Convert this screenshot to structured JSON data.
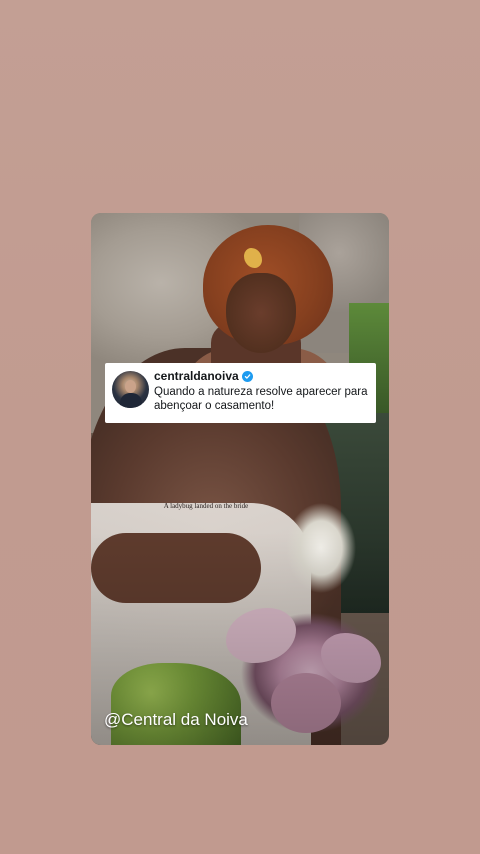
{
  "tweet": {
    "username": "centraldanoiva",
    "verified": true,
    "text": "Quando a natureza resolve aparecer para abençoar o casamento!",
    "avatar_icon": "profile-photo-icon",
    "verified_icon": "verified-check-icon",
    "verified_color": "#1d9bf0"
  },
  "video": {
    "caption": "A ladybug landed on the bride"
  },
  "watermark": "@Central da Noiva",
  "colors": {
    "background": "#c19c91"
  }
}
